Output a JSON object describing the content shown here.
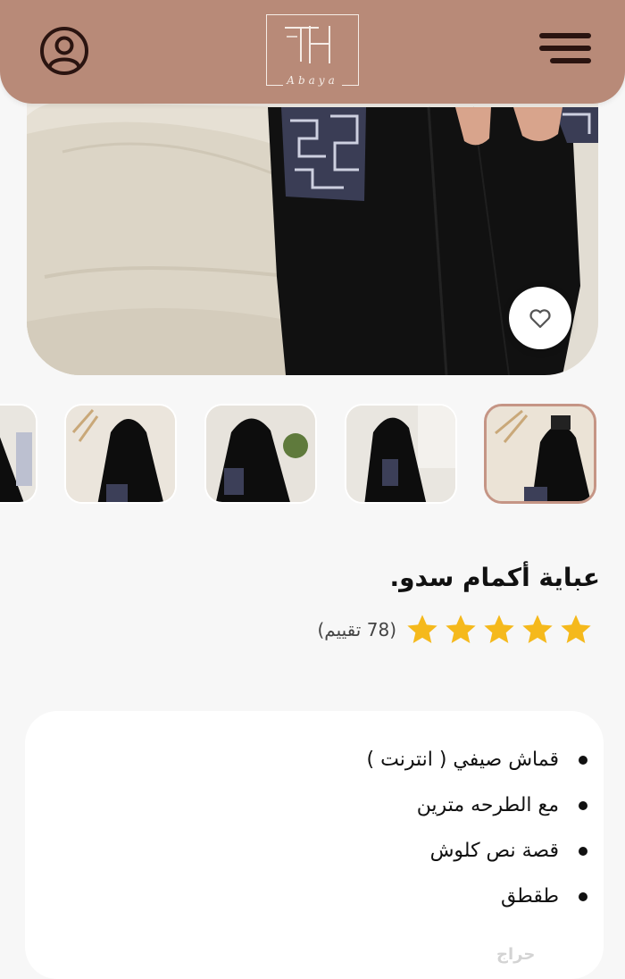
{
  "header": {
    "logo_text": "Abaya",
    "user_icon": "user-circle-icon",
    "menu_icon": "hamburger-menu-icon",
    "bg_color": "#b88a78"
  },
  "product": {
    "title": "عباية أكمام سدو.",
    "rating_stars": 5,
    "rating_count_text": "(78 تقييم)",
    "features": [
      "قماش صيفي ( انترنت )",
      "مع الطرحه مترين",
      "قصة نص كلوش",
      "طقطق"
    ]
  },
  "gallery": {
    "thumbnail_count": 5,
    "active_index": 0
  },
  "colors": {
    "accent": "#b88a78",
    "active_border": "#c59585",
    "star": "#f5b91c"
  },
  "watermark": "حراج"
}
